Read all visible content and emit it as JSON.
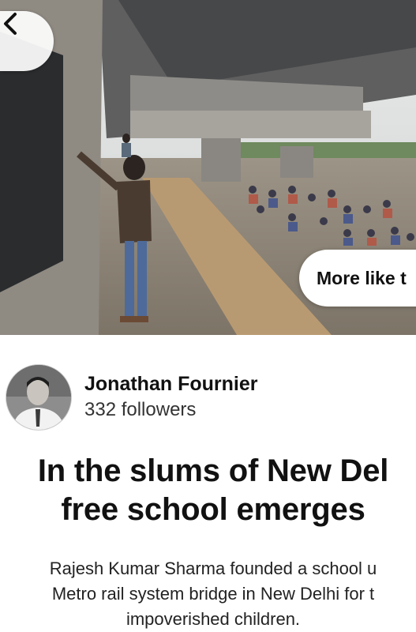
{
  "hero": {
    "more_like_label": "More like t"
  },
  "author": {
    "name": "Jonathan Fournier",
    "followers": "332 followers"
  },
  "post": {
    "title_line1": "In the slums of New Del",
    "title_line2": "free school emerges",
    "description_line1": "Rajesh Kumar Sharma founded a school u",
    "description_line2": "Metro rail system bridge in New Delhi for t",
    "description_line3": "impoverished children."
  },
  "icons": {
    "back": "chevron-left-icon"
  },
  "colors": {
    "text": "#111111",
    "background": "#ffffff"
  }
}
